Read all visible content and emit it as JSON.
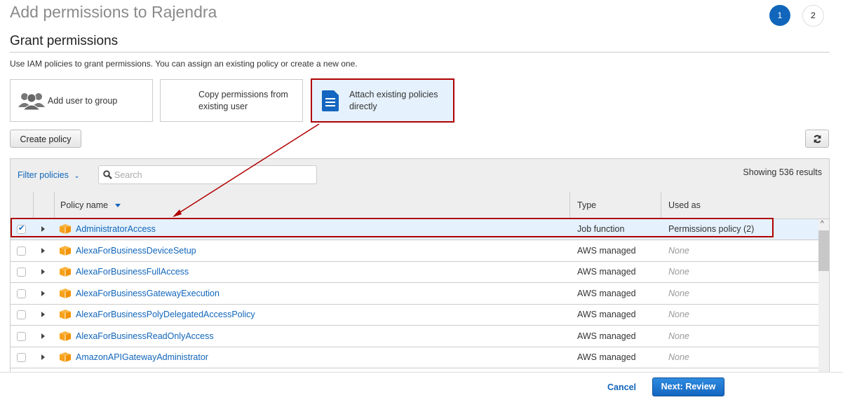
{
  "header": {
    "title": "Add permissions to Rajendra",
    "steps": [
      "1",
      "2"
    ],
    "active_step": "1"
  },
  "section": {
    "title": "Grant permissions",
    "description": "Use IAM policies to grant permissions. You can assign an existing policy or create a new one."
  },
  "options": [
    {
      "label": "Add user to group",
      "icon": "users-group-icon",
      "selected": false
    },
    {
      "label_line1": "Copy permissions from",
      "label_line2": "existing user",
      "selected": false
    },
    {
      "label_line1": "Attach existing policies",
      "label_line2": "directly",
      "icon": "document-icon",
      "selected": true
    }
  ],
  "toolbar": {
    "create_policy": "Create policy",
    "refresh_icon": "refresh-icon"
  },
  "table": {
    "filter_label": "Filter policies",
    "search_placeholder": "Search",
    "showing": "Showing 536 results",
    "columns": [
      "Policy name",
      "Type",
      "Used as"
    ],
    "rows": [
      {
        "name": "AdministratorAccess",
        "type": "Job function",
        "used_as": "Permissions policy (2)",
        "checked": true
      },
      {
        "name": "AlexaForBusinessDeviceSetup",
        "type": "AWS managed",
        "used_as": "None",
        "checked": false
      },
      {
        "name": "AlexaForBusinessFullAccess",
        "type": "AWS managed",
        "used_as": "None",
        "checked": false
      },
      {
        "name": "AlexaForBusinessGatewayExecution",
        "type": "AWS managed",
        "used_as": "None",
        "checked": false
      },
      {
        "name": "AlexaForBusinessPolyDelegatedAccessPolicy",
        "type": "AWS managed",
        "used_as": "None",
        "checked": false
      },
      {
        "name": "AlexaForBusinessReadOnlyAccess",
        "type": "AWS managed",
        "used_as": "None",
        "checked": false
      },
      {
        "name": "AmazonAPIGatewayAdministrator",
        "type": "AWS managed",
        "used_as": "None",
        "checked": false
      }
    ]
  },
  "footer": {
    "cancel": "Cancel",
    "next": "Next: Review"
  },
  "colors": {
    "accent": "#1166bb",
    "annotation": "#b00000",
    "selected_bg": "#e5f1fc",
    "policy_icon": "#f7a21b"
  }
}
